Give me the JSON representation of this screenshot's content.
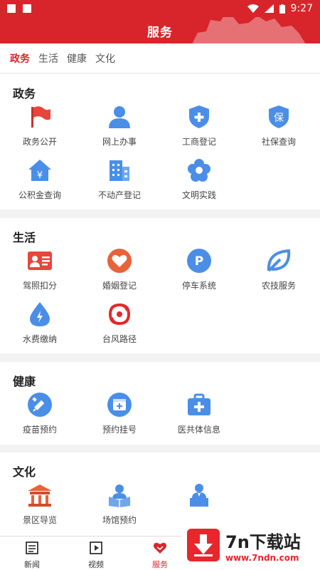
{
  "status_bar": {
    "time": "9:27"
  },
  "header": {
    "title": "服务"
  },
  "tabs": [
    {
      "label": "政务",
      "active": true
    },
    {
      "label": "生活",
      "active": false
    },
    {
      "label": "健康",
      "active": false
    },
    {
      "label": "文化",
      "active": false
    }
  ],
  "sections": {
    "gov": {
      "title": "政务",
      "items": [
        {
          "label": "政务公开",
          "icon": "flag-icon"
        },
        {
          "label": "网上办事",
          "icon": "person-icon"
        },
        {
          "label": "工商登记",
          "icon": "shield-plus-icon"
        },
        {
          "label": "社保查询",
          "icon": "shield-bao-icon"
        },
        {
          "label": "公积金查询",
          "icon": "house-yen-icon"
        },
        {
          "label": "不动产登记",
          "icon": "buildings-icon"
        },
        {
          "label": "文明实践",
          "icon": "flower-icon"
        }
      ]
    },
    "life": {
      "title": "生活",
      "items": [
        {
          "label": "驾照扣分",
          "icon": "id-card-icon"
        },
        {
          "label": "婚姻登记",
          "icon": "heart-icon"
        },
        {
          "label": "停车系统",
          "icon": "parking-icon"
        },
        {
          "label": "农技服务",
          "icon": "leaf-icon"
        },
        {
          "label": "水费缴纳",
          "icon": "water-drop-icon"
        },
        {
          "label": "台风路径",
          "icon": "typhoon-icon"
        }
      ]
    },
    "health": {
      "title": "健康",
      "items": [
        {
          "label": "疫苗预约",
          "icon": "syringe-icon"
        },
        {
          "label": "预约挂号",
          "icon": "calendar-plus-icon"
        },
        {
          "label": "医共体信息",
          "icon": "medical-kit-icon"
        }
      ]
    },
    "culture": {
      "title": "文化",
      "items": [
        {
          "label": "景区导览",
          "icon": "temple-icon"
        },
        {
          "label": "场馆预约",
          "icon": "reader-icon"
        },
        {
          "label": "",
          "icon": "speaker-podium-icon"
        }
      ]
    }
  },
  "bottom_nav": [
    {
      "label": "新闻",
      "icon": "news-icon",
      "active": false
    },
    {
      "label": "视频",
      "icon": "video-icon",
      "active": false
    },
    {
      "label": "服务",
      "icon": "service-icon",
      "active": true
    }
  ],
  "watermark": {
    "main": "7n下载站",
    "sub": "www.7ndn.com"
  },
  "colors": {
    "brand_red": "#d8252b",
    "icon_blue": "#4a8ee8",
    "icon_red": "#e8453c",
    "icon_orange": "#e8623a"
  }
}
